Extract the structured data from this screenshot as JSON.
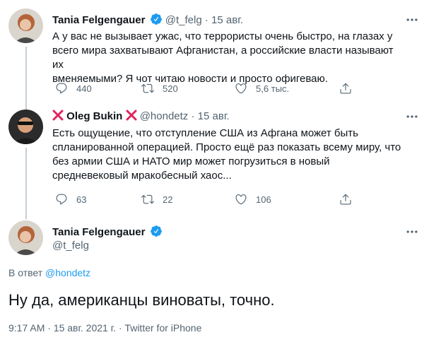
{
  "colors": {
    "accent": "#1d9bf0",
    "verified": "#1d9bf0",
    "x_mark": "#e0245e",
    "text": "#0f1419",
    "secondary": "#536471"
  },
  "tweets": [
    {
      "name": "Tania Felgengauer",
      "handle": "@t_felg",
      "dot": "·",
      "date": "15 авг.",
      "lines": [
        "А у вас не вызывает ужас, что террористы очень быстро, на глазах у",
        "всего мира захватывают Афганистан, а российские власти называют их",
        "вменяемыми? Я чот читаю новости и просто офигеваю."
      ],
      "replies": "440",
      "retweets": "520",
      "likes": "5,6 тыс."
    },
    {
      "name": "Oleg Bukin",
      "handle": "@hondetz",
      "dot": "·",
      "date": "15 авг.",
      "lines": [
        "Есть ощущение, что отступление США из Афгана может быть",
        "спланированной операцией. Просто ещё раз показать всему миру, что",
        "без армии США и НАТО мир может погрузиться в новый",
        "средневековый мракобесный хаос..."
      ],
      "replies": "63",
      "retweets": "22",
      "likes": "106"
    }
  ],
  "main_tweet": {
    "name": "Tania Felgengauer",
    "handle": "@t_felg",
    "reply_prefix": "В ответ",
    "reply_handle": "@hondetz",
    "text": "Ну да, американцы виноваты, точно.",
    "meta": "9:17 AM · 15 авг. 2021 г. · Twitter for iPhone"
  }
}
